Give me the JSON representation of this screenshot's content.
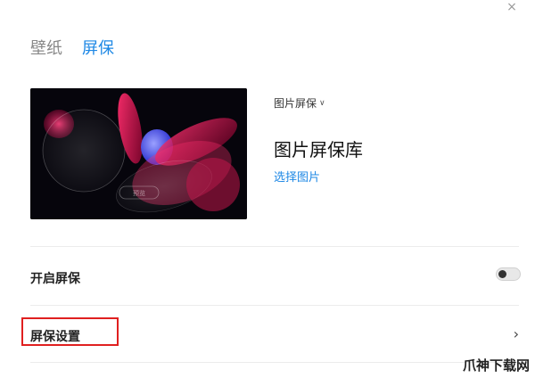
{
  "window": {
    "close_label": "×"
  },
  "tabs": [
    {
      "label": "壁纸",
      "active": false
    },
    {
      "label": "屏保",
      "active": true
    }
  ],
  "screensaver": {
    "type_selector": "图片屏保",
    "library_title": "图片屏保库",
    "choose_images_link": "选择图片",
    "preview_button": "预览"
  },
  "settings": {
    "enable_label": "开启屏保",
    "enable_on": false,
    "settings_label": "屏保设置",
    "settings_arrow": "›"
  },
  "watermark": "爪神下载网",
  "colors": {
    "accent": "#1e88e5",
    "highlight": "#e02020"
  }
}
